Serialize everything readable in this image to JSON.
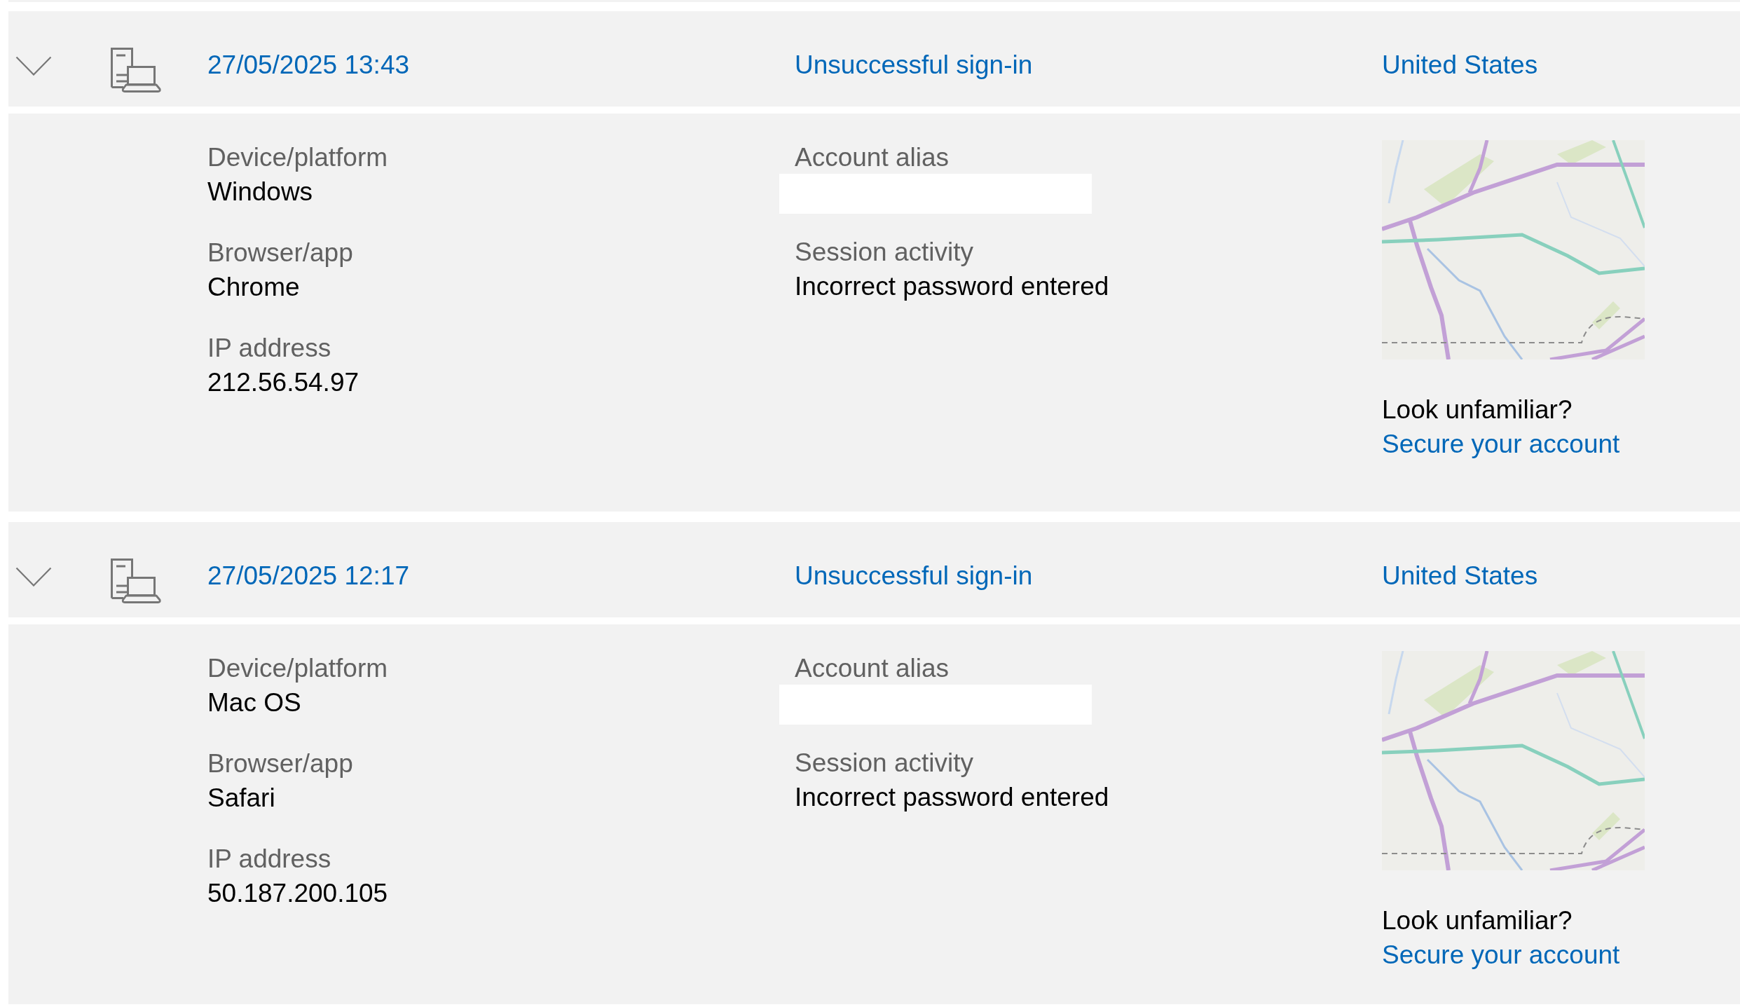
{
  "activities": [
    {
      "date_time": "27/05/2025 13:43",
      "status": "Unsuccessful sign-in",
      "location": "United States",
      "expanded": true,
      "device_info": [
        {
          "label": "Device/platform",
          "value": "Windows"
        },
        {
          "label": "Browser/app",
          "value": "Chrome"
        },
        {
          "label": "IP address",
          "value": "212.56.54.97"
        }
      ],
      "session_info": [
        {
          "label": "Account alias",
          "redacted": true
        },
        {
          "label": "Session activity",
          "value": "Incorrect password entered",
          "redacted": false
        }
      ],
      "location_help": {
        "prompt": "Look unfamiliar?",
        "link": "Secure your account"
      }
    },
    {
      "date_time": "27/05/2025 12:17",
      "status": "Unsuccessful sign-in",
      "location": "United States",
      "expanded": true,
      "device_info": [
        {
          "label": "Device/platform",
          "value": "Mac OS"
        },
        {
          "label": "Browser/app",
          "value": "Safari"
        },
        {
          "label": "IP address",
          "value": "50.187.200.105"
        }
      ],
      "session_info": [
        {
          "label": "Account alias",
          "redacted": true
        },
        {
          "label": "Session activity",
          "value": "Incorrect password entered",
          "redacted": false
        }
      ],
      "location_help": {
        "prompt": "Look unfamiliar?",
        "link": "Secure your account"
      }
    }
  ]
}
